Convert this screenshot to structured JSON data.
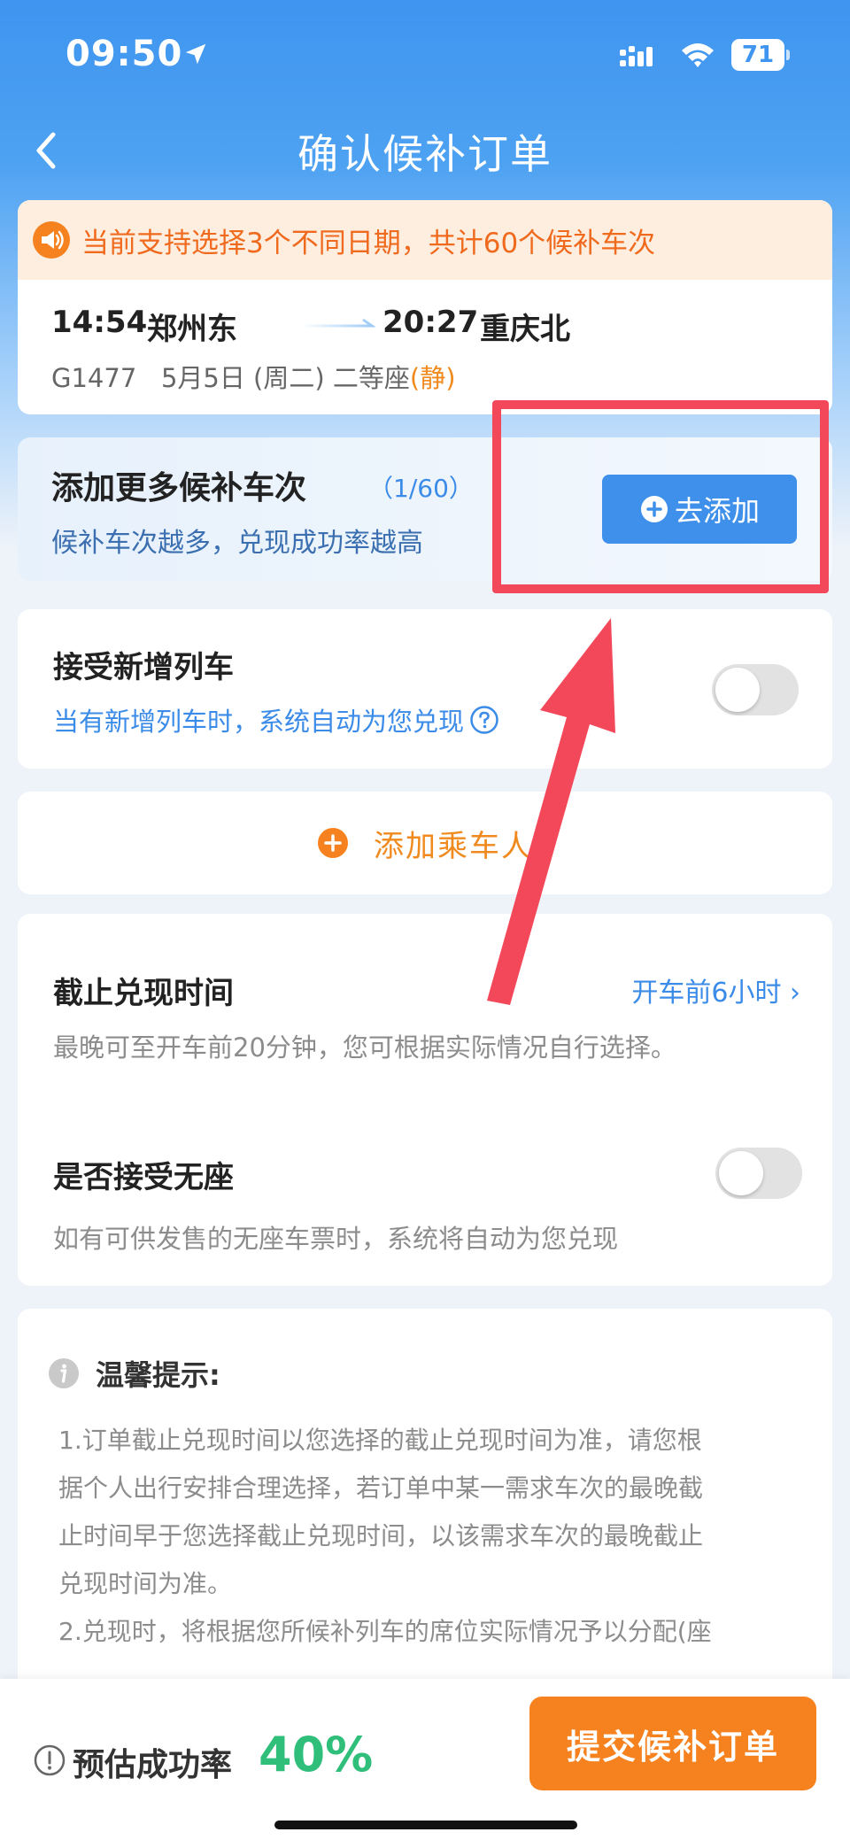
{
  "status_bar": {
    "time": "09:50",
    "battery": "71"
  },
  "nav": {
    "title": "确认候补订单"
  },
  "notice": {
    "text": "当前支持选择3个不同日期，共计60个候补车次"
  },
  "trip": {
    "depart_time": "14:54",
    "depart_station": "郑州东",
    "arrive_time": "20:27",
    "arrive_station": "重庆北",
    "train_no": "G1477",
    "date": "5月5日 (周二)",
    "seat": "二等座",
    "seat_tag": "(静)"
  },
  "more_trains": {
    "title": "添加更多候补车次",
    "count": "（1/60）",
    "subtitle": "候补车次越多，兑现成功率越高",
    "button": "去添加"
  },
  "new_trains": {
    "title": "接受新增列车",
    "subtitle": "当有新增列车时，系统自动为您兑现",
    "enabled": false
  },
  "passenger": {
    "label": "添加乘车人"
  },
  "deadline": {
    "title": "截止兑现时间",
    "value": "开车前6小时",
    "subtitle": "最晚可至开车前20分钟，您可根据实际情况自行选择。"
  },
  "standing": {
    "title": "是否接受无座",
    "subtitle": "如有可供发售的无座车票时，系统将自动为您兑现",
    "enabled": false
  },
  "tips": {
    "title": "温馨提示:",
    "lines": [
      "1.订单截止兑现时间以您选择的截止兑现时间为准，请您根",
      "据个人出行安排合理选择，若订单中某一需求车次的最晚截",
      "止时间早于您选择截止兑现时间，以该需求车次的最晚截止",
      "兑现时间为准。",
      "2.兑现时，将根据您所候补列车的席位实际情况予以分配(座"
    ]
  },
  "bottom": {
    "rate_label": "预估成功率",
    "rate_value": "40%",
    "submit": "提交候补订单"
  },
  "colors": {
    "primary_blue": "#3e90ea",
    "orange": "#f5821f",
    "annotation_red": "#f3485a",
    "success_green": "#2fbf7a"
  }
}
